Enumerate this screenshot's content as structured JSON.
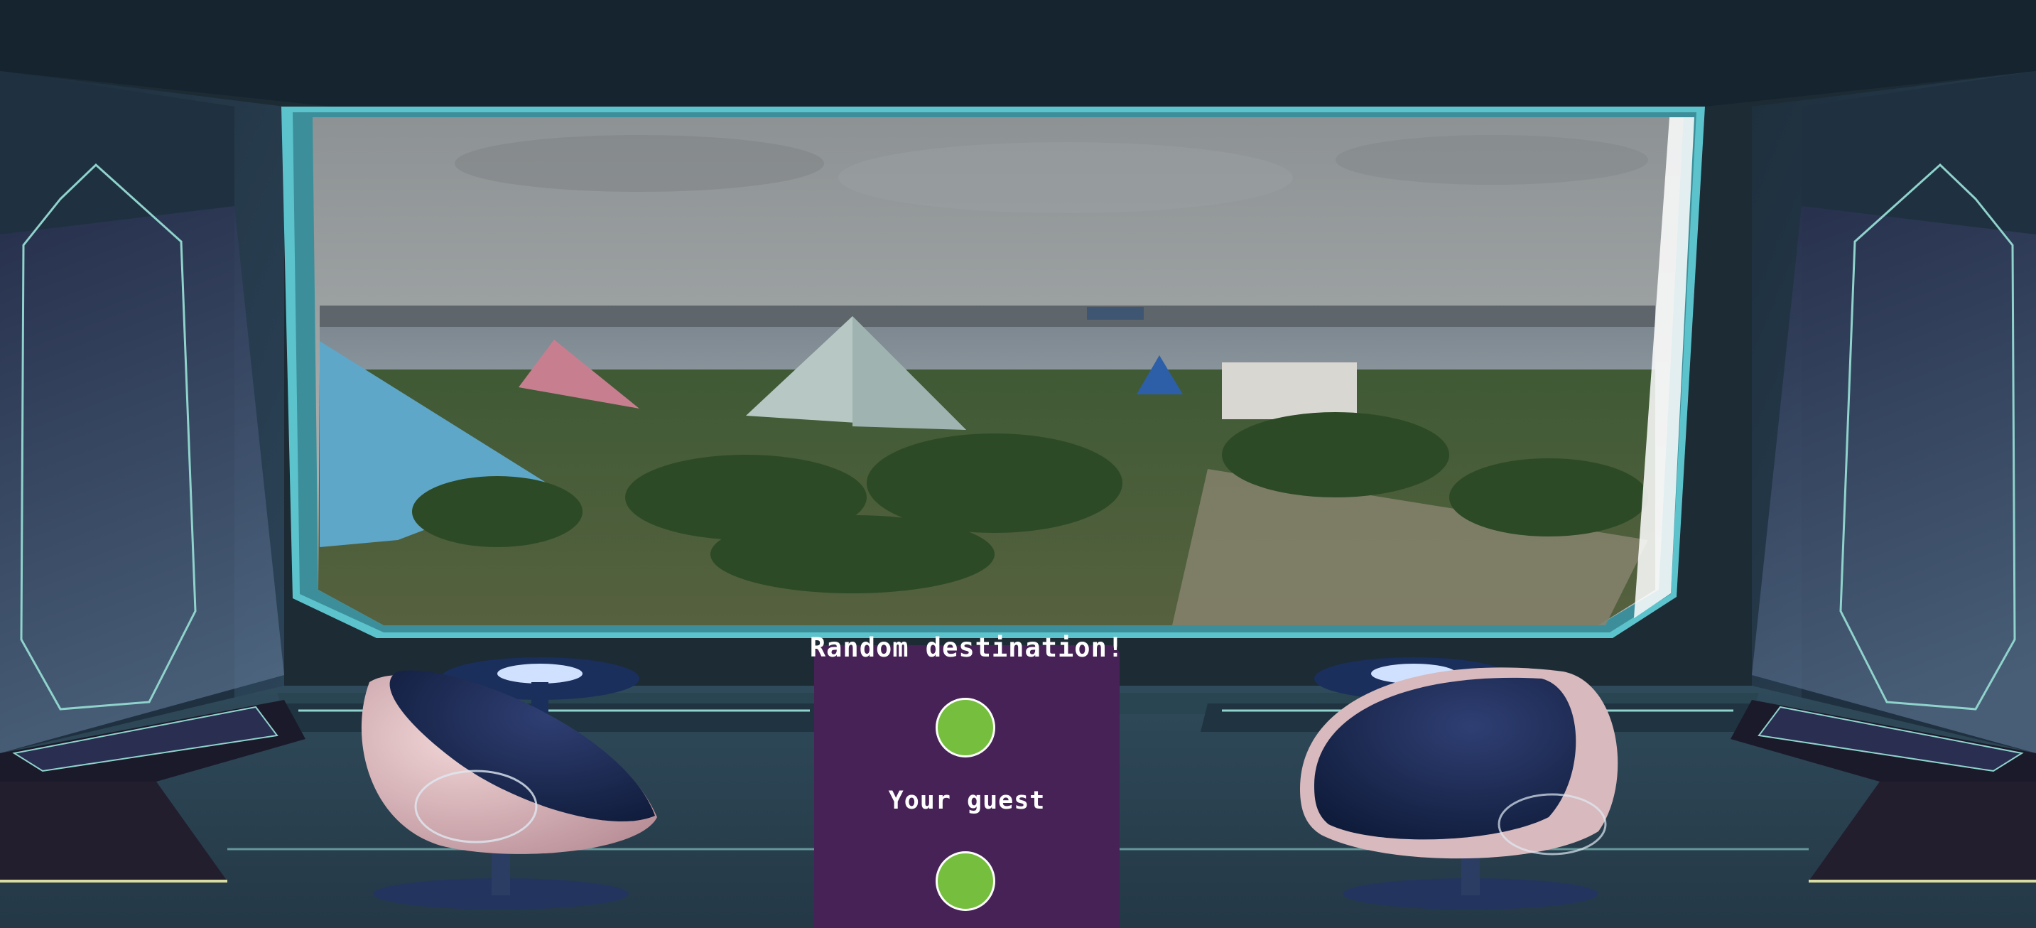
{
  "scene": {
    "window_view": "cockpit-window-view",
    "colors": {
      "frame_teal": "#5cc3cc",
      "panel_purple": "#472256",
      "indicator_green": "#76bf3e",
      "room_dark": "#1b2a33"
    }
  },
  "panel": {
    "title": "Random destination!",
    "guest_label": "Your guest",
    "indicators": [
      {
        "name": "destination-indicator",
        "color": "#76bf3e"
      },
      {
        "name": "guest-indicator",
        "color": "#76bf3e"
      }
    ]
  }
}
